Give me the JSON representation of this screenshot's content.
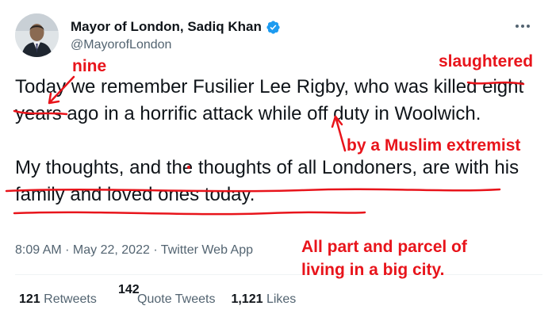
{
  "tweet": {
    "display_name": "Mayor of London, Sadiq Khan",
    "handle": "@MayorofLondon",
    "paragraph1": "Today we remember Fusilier Lee Rigby, who was killed eight years ago in a horrific attack while off duty in Woolwich.",
    "paragraph2": "My thoughts, and the thoughts of all Londoners, are with his family and loved ones today.",
    "timestamp": "8:09 AM · May 22, 2022 · Twitter Web App",
    "retweets": "121",
    "retweets_label": "Retweets",
    "quote_tweets": "142",
    "quote_tweets_label": "Quote Tweets",
    "likes": "1,121",
    "likes_label": "Likes",
    "more_icon": "more-horizontal-icon",
    "verified_icon": "verified-badge-icon"
  },
  "annotations": {
    "nine": "nine",
    "slaughtered": "slaughtered",
    "muslim": "by a Muslim extremist",
    "parcel_line1": "All part and parcel of",
    "parcel_line2": "living in a big city.",
    "color": "#e8141b"
  },
  "colors": {
    "text": "#0f1419",
    "secondary": "#536471",
    "verified": "#1d9bf0",
    "divider": "#eff3f4"
  }
}
